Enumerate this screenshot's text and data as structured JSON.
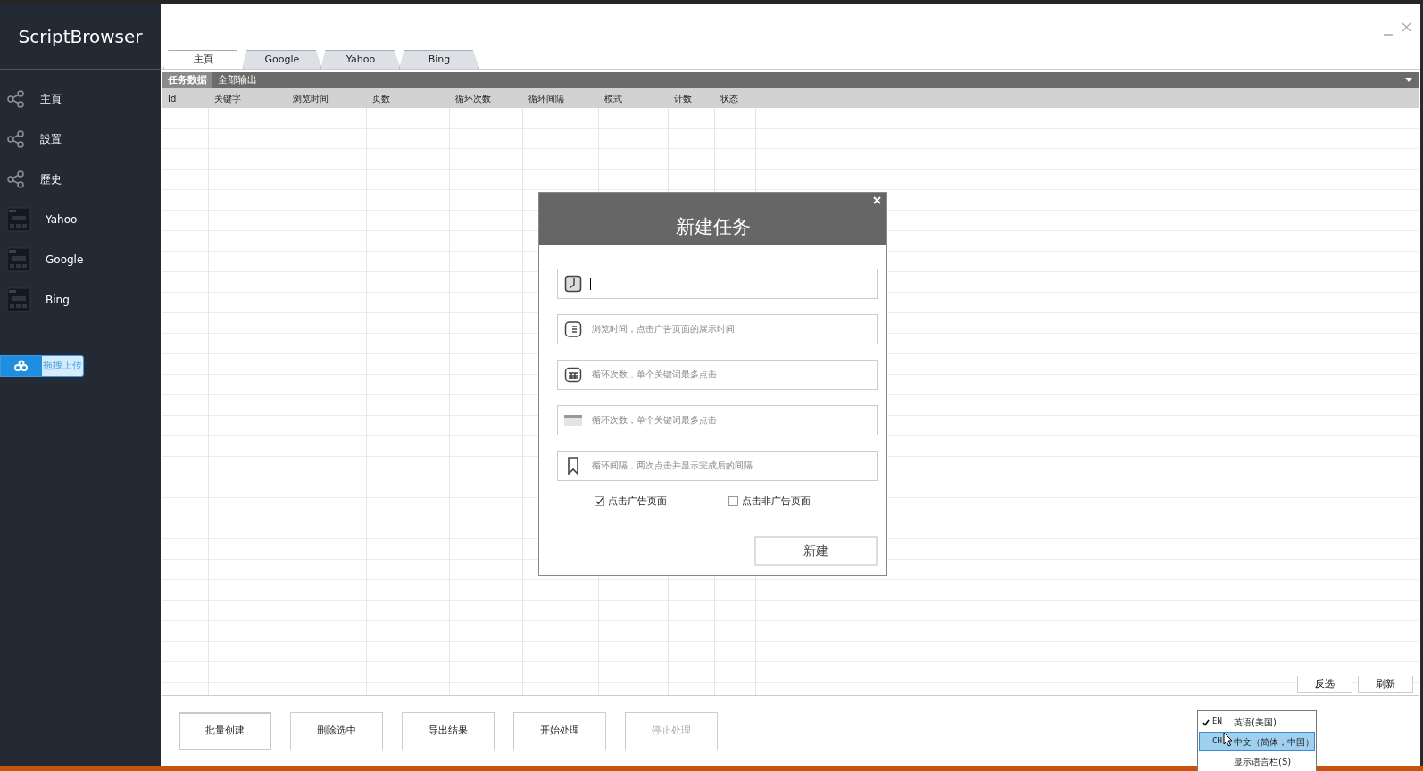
{
  "app": {
    "title": "ScriptBrowser"
  },
  "sidebar": {
    "items": [
      {
        "label": "主頁",
        "kind": "share"
      },
      {
        "label": "設置",
        "kind": "share"
      },
      {
        "label": "歷史",
        "kind": "share"
      },
      {
        "label": "Yahoo",
        "kind": "browser"
      },
      {
        "label": "Google",
        "kind": "browser"
      },
      {
        "label": "Bing",
        "kind": "browser"
      }
    ],
    "upload_button": "拖拽上传"
  },
  "tabs": [
    {
      "label": "主頁",
      "selected": true
    },
    {
      "label": "Google",
      "selected": false
    },
    {
      "label": "Yahoo",
      "selected": false
    },
    {
      "label": "Bing",
      "selected": false
    }
  ],
  "grid": {
    "toolbar_tabs": [
      {
        "label": "任务数据",
        "selected": true
      },
      {
        "label": "全部输出",
        "selected": false
      }
    ],
    "columns": [
      "Id",
      "关键字",
      "浏览时间",
      "页数",
      "循环次数",
      "循环间隔",
      "模式",
      "计数",
      "状态"
    ],
    "buttons": [
      "反选",
      "刷新"
    ]
  },
  "actions": [
    {
      "label": "批量创建",
      "disabled": false,
      "focused": true
    },
    {
      "label": "删除选中",
      "disabled": false,
      "focused": false
    },
    {
      "label": "导出结果",
      "disabled": false,
      "focused": false
    },
    {
      "label": "开始处理",
      "disabled": false,
      "focused": false
    },
    {
      "label": "停止处理",
      "disabled": true,
      "focused": false
    }
  ],
  "dialog": {
    "title": "新建任务",
    "fields": [
      {
        "focused": true
      },
      {
        "placeholder": "浏览时间，点击广告页面的展示时间",
        "focused": false
      },
      {
        "placeholder": "循环次数，单个关键词最多点击",
        "focused": false
      },
      {
        "placeholder": "循环次数，单个关键词最多点击",
        "focused": false
      },
      {
        "placeholder": "循环间隔，两次点击并显示完成后的间隔",
        "focused": false
      }
    ],
    "checkboxes": [
      {
        "label": "点击广告页面",
        "checked": true
      },
      {
        "label": "点击非广告页面",
        "checked": false
      }
    ],
    "submit": "新建"
  },
  "language_menu": {
    "items": [
      {
        "code": "EN",
        "label": "英语(美国)",
        "checked": true,
        "selected": false
      },
      {
        "code": "CH",
        "label": "中文（简体，中国）",
        "checked": false,
        "selected": true
      },
      {
        "label": "显示语言栏(S)",
        "checked": false,
        "selected": false
      }
    ]
  }
}
